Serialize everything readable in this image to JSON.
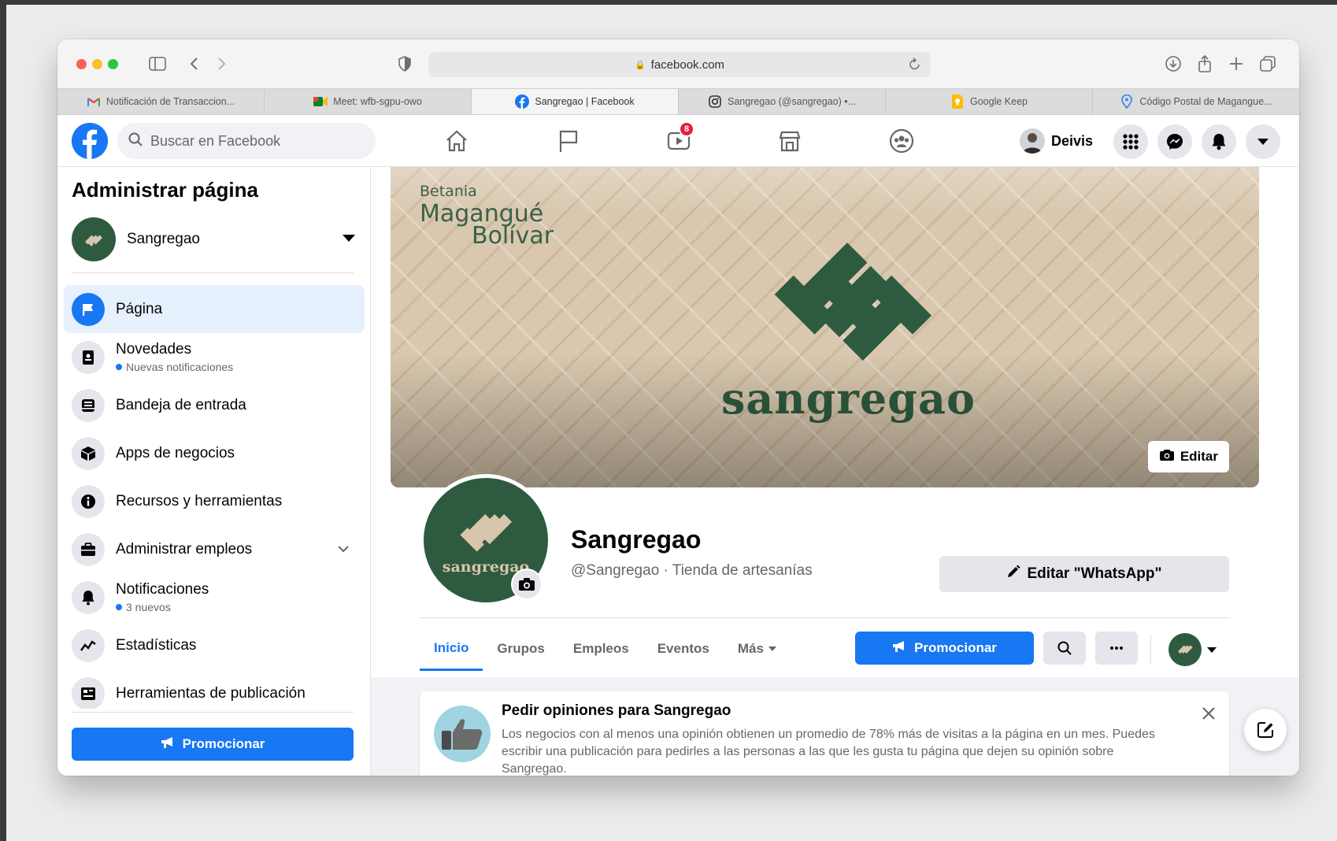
{
  "browser": {
    "url": "facebook.com",
    "tabs": [
      {
        "label": "Notificación de Transaccion...",
        "icon": "gmail-icon"
      },
      {
        "label": "Meet: wfb-sgpu-owo",
        "icon": "meet-icon"
      },
      {
        "label": "Sangregao | Facebook",
        "icon": "facebook-icon",
        "active": true
      },
      {
        "label": "Sangregao (@sangregao) •...",
        "icon": "instagram-icon"
      },
      {
        "label": "Google Keep",
        "icon": "keep-icon"
      },
      {
        "label": "Código Postal de Magangue...",
        "icon": "map-pin-icon"
      }
    ]
  },
  "header": {
    "search_placeholder": "Buscar en Facebook",
    "watch_badge": "8",
    "user_name": "Deivis"
  },
  "sidebar": {
    "title": "Administrar página",
    "page_name": "Sangregao",
    "items": [
      {
        "label": "Página",
        "icon": "flag-icon",
        "active": true
      },
      {
        "label": "Novedades",
        "icon": "news-icon",
        "sub": "Nuevas notificaciones"
      },
      {
        "label": "Bandeja de entrada",
        "icon": "inbox-icon"
      },
      {
        "label": "Apps de negocios",
        "icon": "cube-icon"
      },
      {
        "label": "Recursos y herramientas",
        "icon": "info-icon"
      },
      {
        "label": "Administrar empleos",
        "icon": "briefcase-icon"
      },
      {
        "label": "Notificaciones",
        "icon": "bell-icon",
        "sub": "3 nuevos"
      },
      {
        "label": "Estadísticas",
        "icon": "chart-icon"
      },
      {
        "label": "Herramientas de publicación",
        "icon": "publishing-icon"
      }
    ],
    "promote_label": "Promocionar"
  },
  "cover": {
    "tag_line1": "Betania",
    "tag_line2": "Magangué",
    "tag_line3": "Bolívar",
    "brand": "sangregao",
    "edit_label": "Editar"
  },
  "profile": {
    "avatar_text": "sangregao",
    "name": "Sangregao",
    "subtitle": "@Sangregao · Tienda de artesanías",
    "whatsapp_label": "Editar \"WhatsApp\"",
    "tabs": [
      "Inicio",
      "Grupos",
      "Empleos",
      "Eventos",
      "Más"
    ],
    "promote_label": "Promocionar"
  },
  "review_card": {
    "title": "Pedir opiniones para Sangregao",
    "body": "Los negocios con al menos una opinión obtienen un promedio de 78% más de visitas a la página en un mes. Puedes escribir una publicación para pedirles a las personas a las que les gusta tu página que dejen su opinión sobre Sangregao."
  },
  "colors": {
    "fb_blue": "#1877f2",
    "brand_green": "#2e5b3f",
    "cover_beige": "#d7c5ac"
  }
}
